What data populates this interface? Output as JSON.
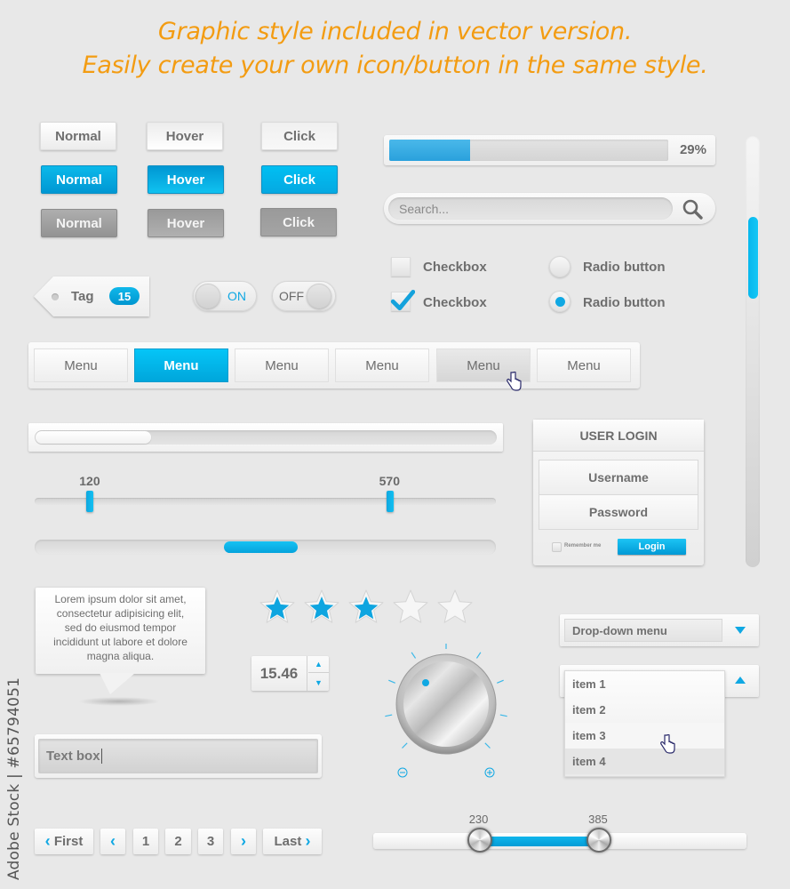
{
  "headline": {
    "line1": "Graphic style included in vector version.",
    "line2": "Easily create your own icon/button in the same style."
  },
  "button_grid": {
    "rows": [
      {
        "style": "white",
        "buttons": [
          "Normal",
          "Hover",
          "Click"
        ]
      },
      {
        "style": "blue",
        "buttons": [
          "Normal",
          "Hover",
          "Click"
        ]
      },
      {
        "style": "gray",
        "buttons": [
          "Normal",
          "Hover",
          "Click"
        ]
      }
    ]
  },
  "tag": {
    "label": "Tag",
    "count": "15"
  },
  "toggles": {
    "on_label": "ON",
    "off_label": "OFF"
  },
  "progress": {
    "percent": 29,
    "label": "29%"
  },
  "search": {
    "placeholder": "Search...",
    "icon": "search-icon"
  },
  "checkboxes": [
    {
      "label": "Checkbox",
      "checked": false
    },
    {
      "label": "Checkbox",
      "checked": true
    }
  ],
  "radios": [
    {
      "label": "Radio button",
      "selected": false
    },
    {
      "label": "Radio button",
      "selected": true
    }
  ],
  "menu": {
    "items": [
      "Menu",
      "Menu",
      "Menu",
      "Menu",
      "Menu",
      "Menu"
    ],
    "active_index": 1,
    "hover_index": 4
  },
  "horizontal_scrollbar": {
    "thumb_start_fraction": 0.0,
    "thumb_size_fraction": 0.25
  },
  "range_slider": {
    "min_label": "120",
    "max_label": "570",
    "low_fraction": 0.12,
    "high_fraction": 0.77
  },
  "pill_slider": {
    "position_fraction": 0.41,
    "size_fraction": 0.16
  },
  "login": {
    "title": "USER LOGIN",
    "username_placeholder": "Username",
    "password_placeholder": "Password",
    "remember_label": "Remember me",
    "login_button": "Login"
  },
  "vertical_scrollbar": {
    "thumb_start_fraction": 0.19,
    "thumb_size_fraction": 0.19
  },
  "tooltip": {
    "text_lines": [
      "Lorem ipsum dolor sit amet,",
      "consectetur adipisicing elit,",
      "sed do eiusmod tempor",
      "incididunt ut labore et dolore",
      "magna aliqua."
    ]
  },
  "rating": {
    "value": 3,
    "max": 5
  },
  "stepper": {
    "value": "15.46"
  },
  "knob": {
    "minus_label": "−",
    "plus_label": "+",
    "ticks": 9
  },
  "textbox": {
    "value": "Text box"
  },
  "pagination": {
    "first_label": "First",
    "pages": [
      "1",
      "2",
      "3"
    ],
    "last_label": "Last"
  },
  "dual_slider": {
    "low_label": "230",
    "high_label": "385",
    "low_fraction": 0.285,
    "high_fraction": 0.605
  },
  "dropdown_closed": {
    "label": "Drop-down menu"
  },
  "dropdown_open": {
    "items": [
      "item 1",
      "item 2",
      "item 3",
      "item 4"
    ],
    "hover_index": 2
  },
  "watermark": {
    "side_text": "Adobe Stock | #65794051"
  },
  "colors": {
    "accent_blue": "#0aaee6",
    "headline_orange": "#f39c12",
    "background": "#e8e8e8",
    "text_gray": "#6e6e6e"
  }
}
